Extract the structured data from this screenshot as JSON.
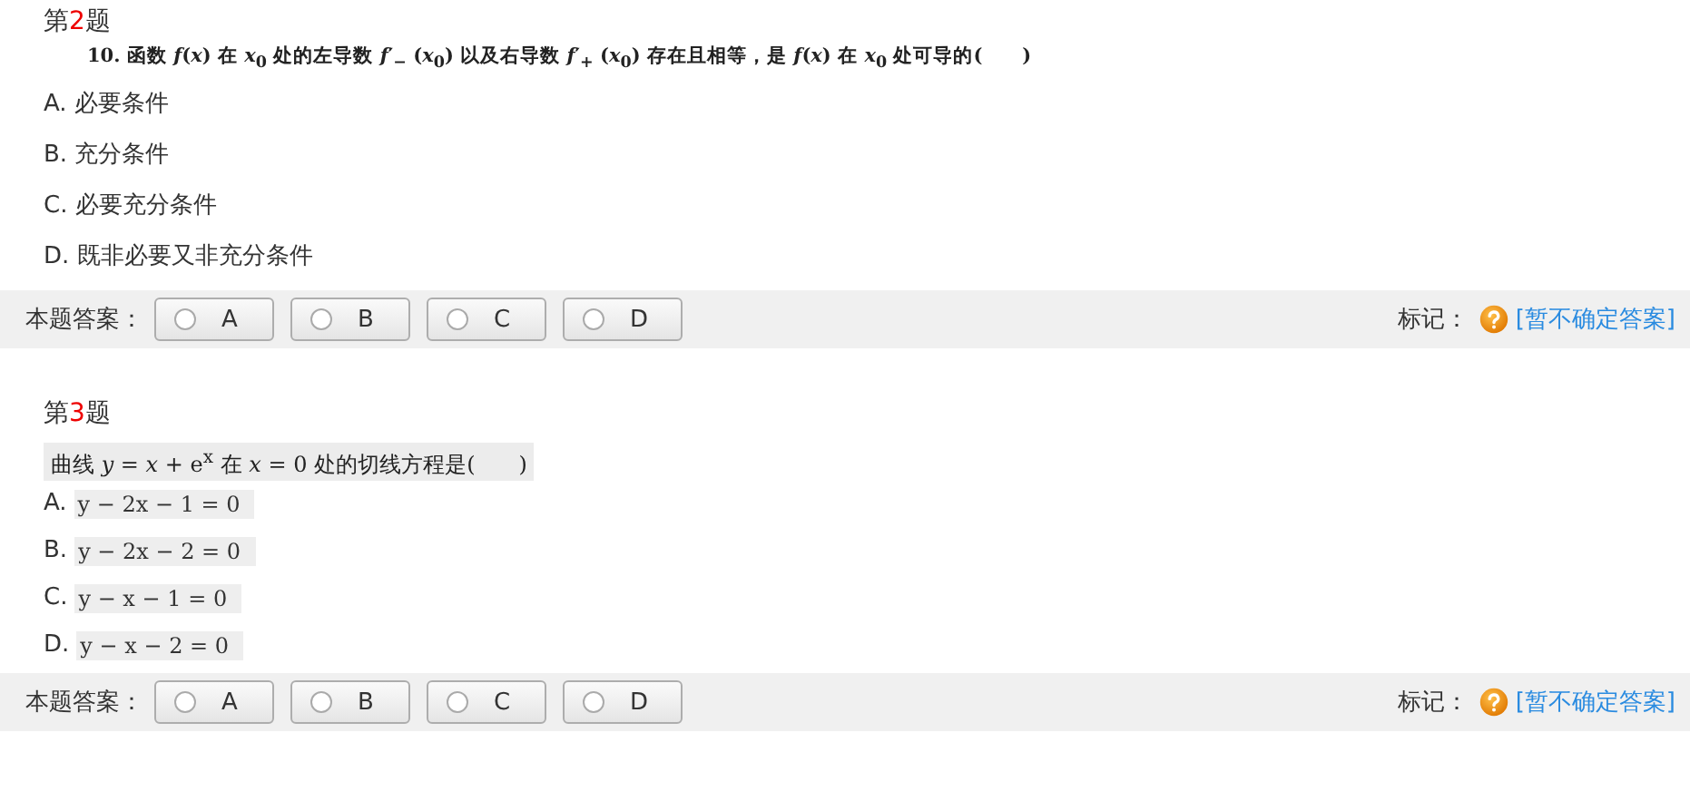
{
  "questions": [
    {
      "title_prefix": "第",
      "number": "2",
      "title_suffix": "题",
      "kind": "plain",
      "stem": "10. 函数 *f*(*x*) 在 *x*$_{0}$ 处的左导数 *f*′$_{−}$ (*x*$_{0}$) 以及右导数 *f*′$_{+}$ (*x*$_{0}$) 存在且相等，是 *f*(*x*) 在 *x*$_{0}$ 处可导的(　　)",
      "options": [
        {
          "letter": "A.",
          "text": "必要条件"
        },
        {
          "letter": "B.",
          "text": "充分条件"
        },
        {
          "letter": "C.",
          "text": "必要充分条件"
        },
        {
          "letter": "D.",
          "text": "既非必要又非充分条件"
        }
      ],
      "answer_label": "本题答案：",
      "choices": [
        {
          "label": "A",
          "selected": false
        },
        {
          "label": "B",
          "selected": false
        },
        {
          "label": "C",
          "selected": false
        },
        {
          "label": "D",
          "selected": false
        }
      ],
      "mark_label": "标记：",
      "mark_link": "[暂不确定答案]"
    },
    {
      "title_prefix": "第",
      "number": "3",
      "title_suffix": "题",
      "kind": "scan",
      "stem": "曲线 *y* = *x* + e$^{x}$ 在 *x* = 0 处的切线方程是(　　)",
      "options": [
        {
          "letter": "A.",
          "text": "y − 2x − 1 = 0"
        },
        {
          "letter": "B.",
          "text": "y − 2x − 2 = 0"
        },
        {
          "letter": "C.",
          "text": "y − x − 1 = 0"
        },
        {
          "letter": "D.",
          "text": "y − x − 2 = 0"
        }
      ],
      "answer_label": "本题答案：",
      "choices": [
        {
          "label": "A",
          "selected": false
        },
        {
          "label": "B",
          "selected": false
        },
        {
          "label": "C",
          "selected": false
        },
        {
          "label": "D",
          "selected": false
        }
      ],
      "mark_label": "标记：",
      "mark_link": "[暂不确定答案]"
    }
  ]
}
